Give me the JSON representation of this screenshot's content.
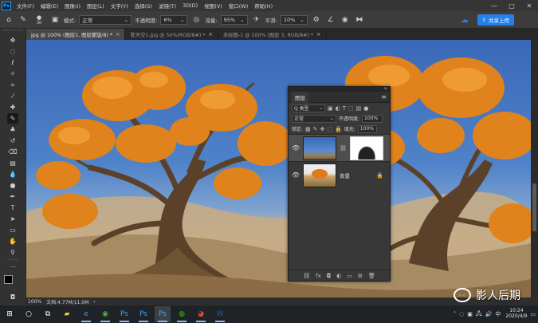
{
  "app": {
    "logo": "Ps"
  },
  "menu": [
    "文件(F)",
    "编辑(E)",
    "图像(I)",
    "图层(L)",
    "文字(Y)",
    "选择(S)",
    "滤镜(T)",
    "3D(D)",
    "视图(V)",
    "窗口(W)",
    "帮助(H)"
  ],
  "window_controls": {
    "minimize": "—",
    "maximize": "□",
    "close": "✕"
  },
  "options": {
    "brush_size": "30",
    "mode_label": "模式:",
    "mode_value": "正常",
    "opacity_label": "不透明度:",
    "opacity_value": "6%",
    "flow_label": "流量:",
    "flow_value": "95%",
    "smooth_label": "平滑:",
    "smooth_value": "10%",
    "share_label": "共享上传"
  },
  "tabs": [
    {
      "label": "jpg @ 100% (图层1, 图层蒙版/8) *",
      "close": "×"
    },
    {
      "label": "陈天空1.jpg @ 50%(RGB/8#) *",
      "close": "×"
    },
    {
      "label": "未标题-1 @ 100% (图层 3, RGB/8#) *",
      "close": "×"
    }
  ],
  "status": {
    "zoom": "100%",
    "doc": "文档:4.77M/11.0M",
    "arrow": "›"
  },
  "layers_panel": {
    "tab": "图层",
    "menu": "≡",
    "filter_label": "Q 类型",
    "blend_mode": "正常",
    "opacity_label": "不透明度:",
    "opacity_value": "100%",
    "lock_label": "锁定:",
    "fill_label": "填充:",
    "fill_value": "100%",
    "layers": [
      {
        "name": "",
        "selected": true
      },
      {
        "name": "背景",
        "selected": false
      }
    ]
  },
  "taskbar": {
    "apps": [
      "start-button",
      "search",
      "task-view",
      "file-explorer",
      "edge",
      "360-browser",
      "photoshop",
      "photoshop-2",
      "photoshop-active",
      "wechat",
      "chrome",
      "word"
    ],
    "time": "10:24",
    "date": "2020/4/9",
    "lang": "中"
  },
  "watermark": {
    "text": "影人后期"
  },
  "colors": {
    "accent": "#2680eb",
    "foreground": "#000000",
    "background": "#ffffff",
    "tree_orange": "#e0831c",
    "sky": "#4a7ec8"
  }
}
